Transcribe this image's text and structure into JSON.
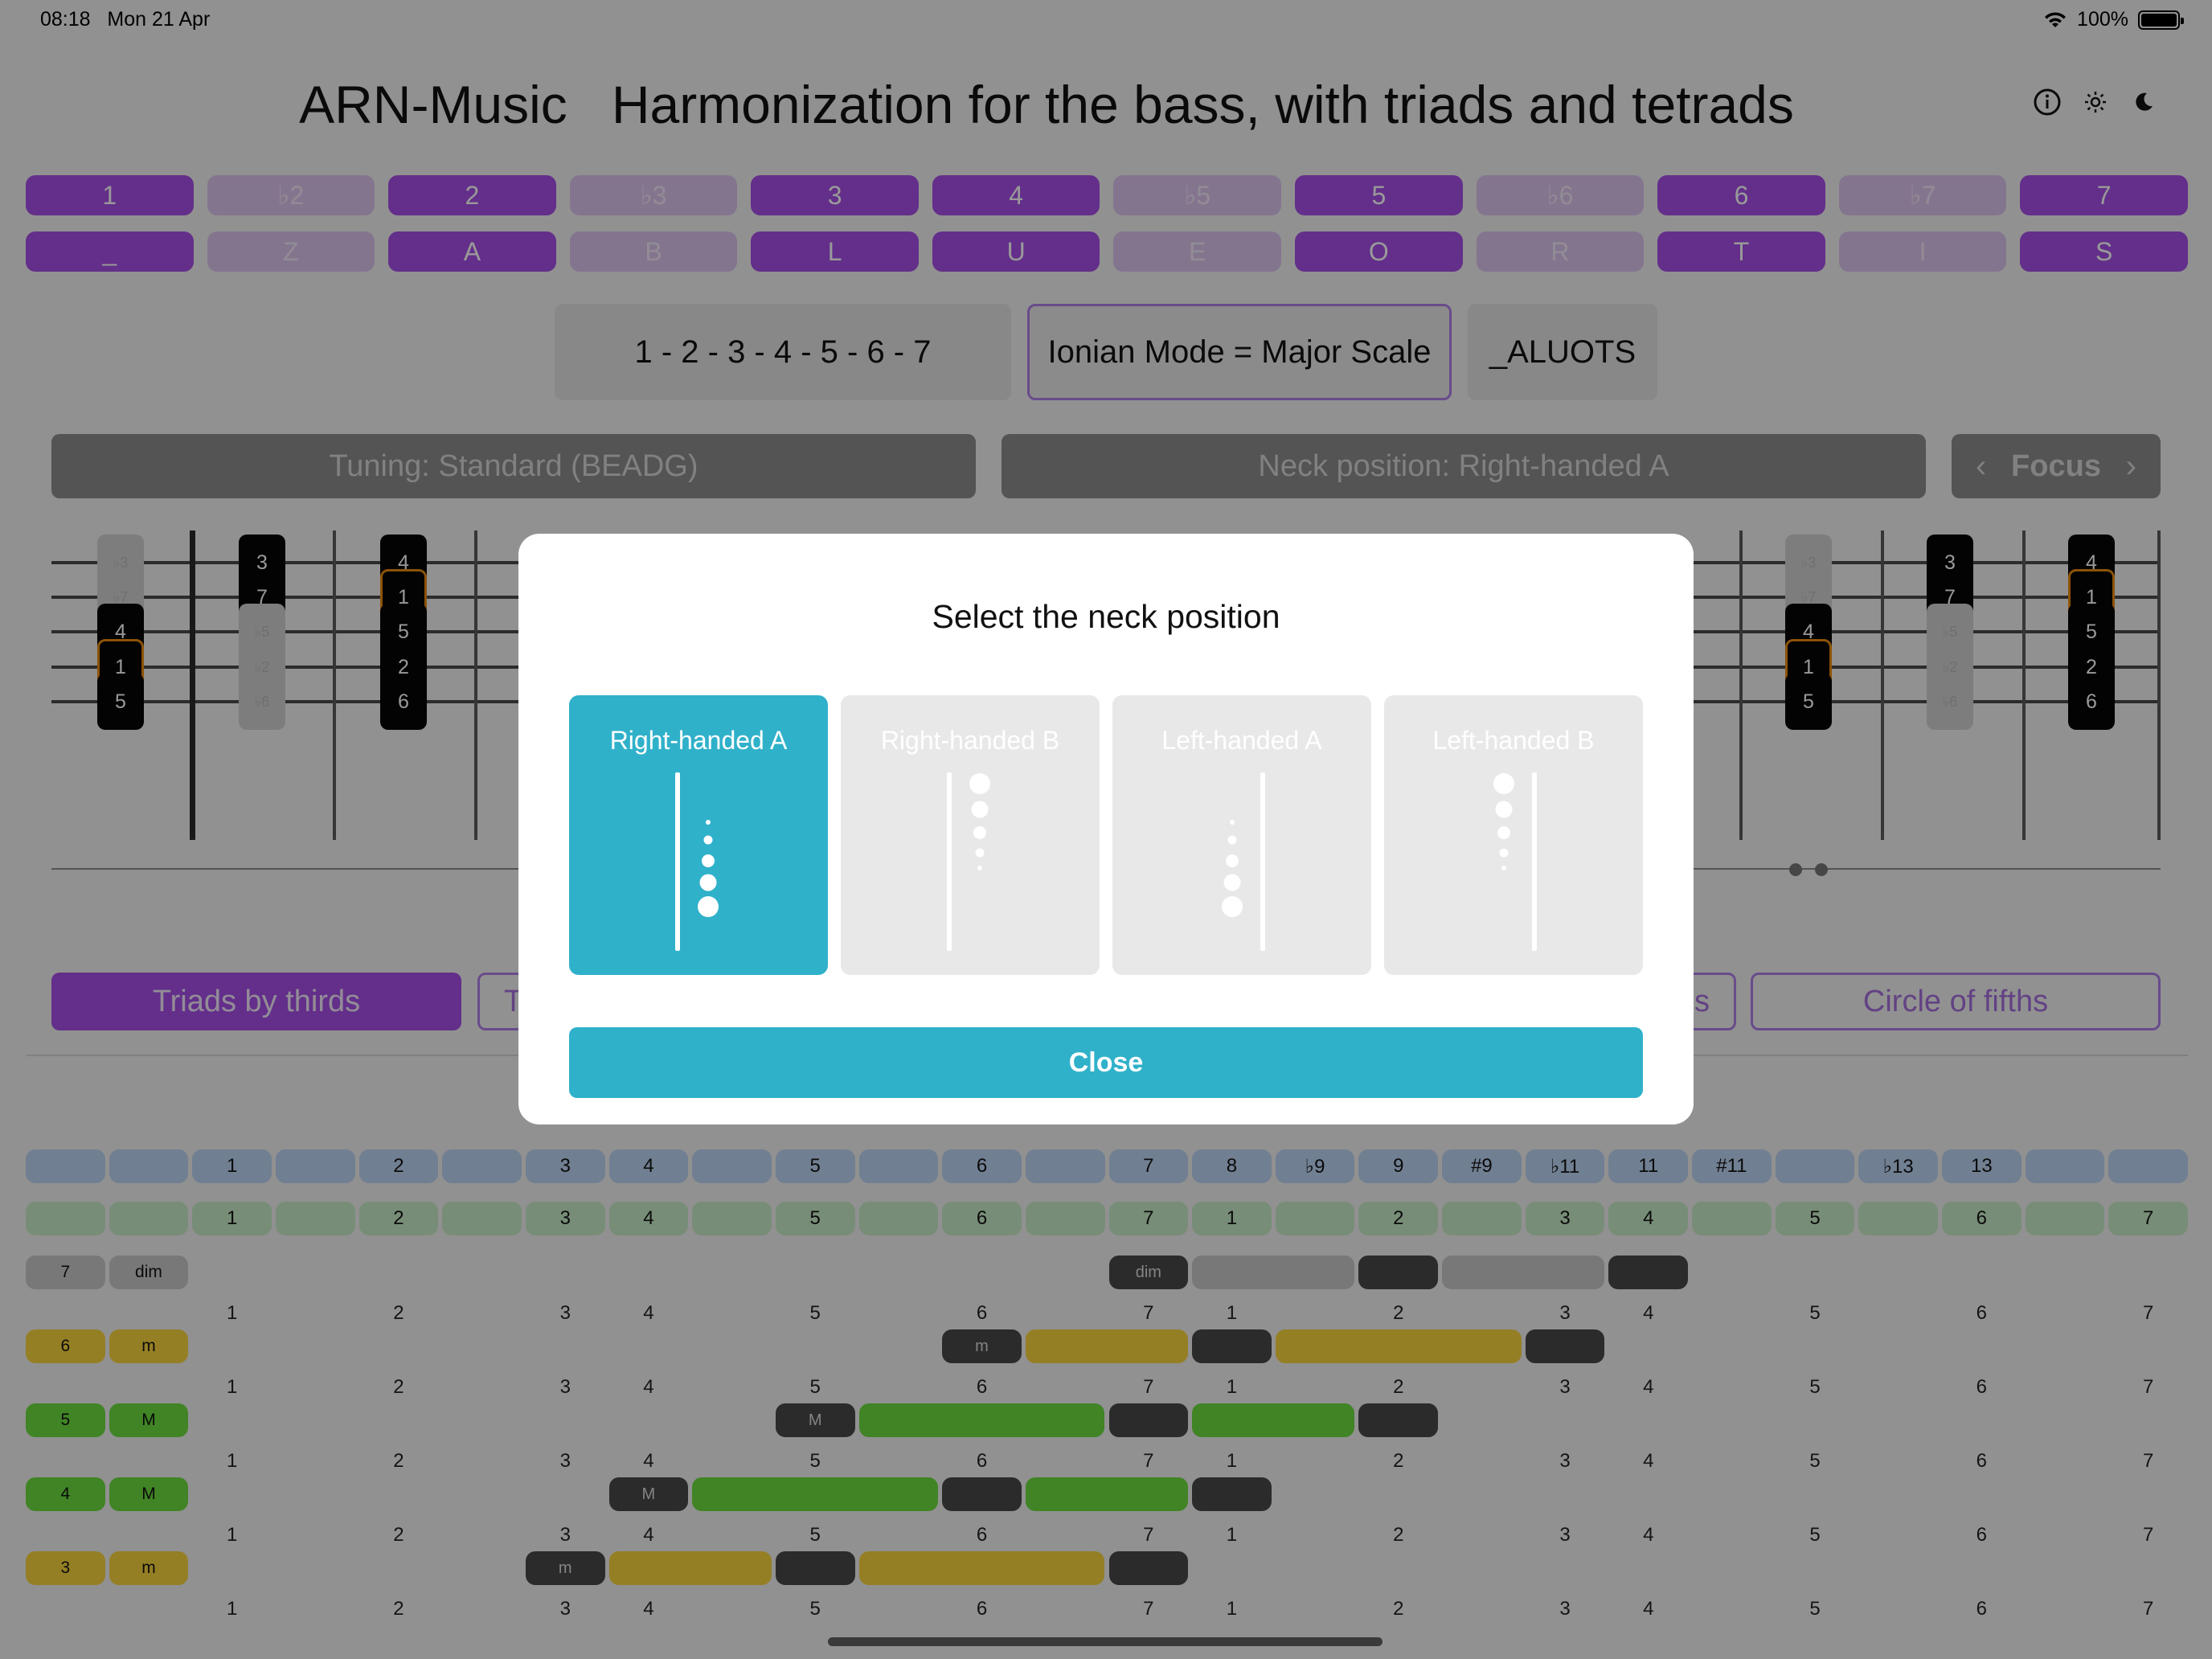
{
  "status": {
    "time": "08:18",
    "date": "Mon 21 Apr",
    "battery": "100%"
  },
  "app": {
    "name": "ARN-Music",
    "subtitle": "Harmonization for the bass, with triads and tetrads"
  },
  "degrees": [
    {
      "label": "1",
      "on": true
    },
    {
      "label": "♭2",
      "on": false
    },
    {
      "label": "2",
      "on": true
    },
    {
      "label": "♭3",
      "on": false
    },
    {
      "label": "3",
      "on": true
    },
    {
      "label": "4",
      "on": true
    },
    {
      "label": "♭5",
      "on": false
    },
    {
      "label": "5",
      "on": true
    },
    {
      "label": "♭6",
      "on": false
    },
    {
      "label": "6",
      "on": true
    },
    {
      "label": "♭7",
      "on": false
    },
    {
      "label": "7",
      "on": true
    }
  ],
  "letters": [
    {
      "label": "_",
      "on": true
    },
    {
      "label": "Z",
      "on": false
    },
    {
      "label": "A",
      "on": true
    },
    {
      "label": "B",
      "on": false
    },
    {
      "label": "L",
      "on": true
    },
    {
      "label": "U",
      "on": true
    },
    {
      "label": "E",
      "on": false
    },
    {
      "label": "O",
      "on": true
    },
    {
      "label": "R",
      "on": false
    },
    {
      "label": "T",
      "on": true
    },
    {
      "label": "I",
      "on": false
    },
    {
      "label": "S",
      "on": true
    }
  ],
  "scale": {
    "formula": "1 - 2 - 3 - 4 - 5 - 6 - 7",
    "mode": "Ionian Mode = Major Scale",
    "code": "_ALUOTS"
  },
  "controls": {
    "tuning": "Tuning: Standard (BEADG)",
    "neck": "Neck position: Right-handed A",
    "focus": "Focus"
  },
  "fretboard": {
    "left_notes": [
      {
        "s": 0,
        "f": 0,
        "t": "♭3",
        "g": true
      },
      {
        "s": 0,
        "f": 1,
        "t": "3"
      },
      {
        "s": 0,
        "f": 2,
        "t": "4"
      },
      {
        "s": 1,
        "f": 0,
        "t": "♭7",
        "g": true
      },
      {
        "s": 1,
        "f": 1,
        "t": "7"
      },
      {
        "s": 1,
        "f": 2,
        "t": "1",
        "r": true
      },
      {
        "s": 2,
        "f": 0,
        "t": "4"
      },
      {
        "s": 2,
        "f": 1,
        "t": "♭5",
        "g": true
      },
      {
        "s": 2,
        "f": 2,
        "t": "5"
      },
      {
        "s": 3,
        "f": 0,
        "t": "1",
        "r": true
      },
      {
        "s": 3,
        "f": 1,
        "t": "♭2",
        "g": true
      },
      {
        "s": 3,
        "f": 2,
        "t": "2"
      },
      {
        "s": 4,
        "f": 0,
        "t": "5"
      },
      {
        "s": 4,
        "f": 1,
        "t": "♭6",
        "g": true
      },
      {
        "s": 4,
        "f": 2,
        "t": "6"
      }
    ],
    "right_notes": [
      {
        "s": 0,
        "f": 0,
        "t": "♭3",
        "g": true
      },
      {
        "s": 0,
        "f": 1,
        "t": "3"
      },
      {
        "s": 0,
        "f": 2,
        "t": "4"
      },
      {
        "s": 1,
        "f": 0,
        "t": "♭7",
        "g": true
      },
      {
        "s": 1,
        "f": 1,
        "t": "7"
      },
      {
        "s": 1,
        "f": 2,
        "t": "1",
        "r": true
      },
      {
        "s": 2,
        "f": 0,
        "t": "4"
      },
      {
        "s": 2,
        "f": 1,
        "t": "♭5",
        "g": true
      },
      {
        "s": 2,
        "f": 2,
        "t": "5"
      },
      {
        "s": 3,
        "f": 0,
        "t": "1",
        "r": true
      },
      {
        "s": 3,
        "f": 1,
        "t": "♭2",
        "g": true
      },
      {
        "s": 3,
        "f": 2,
        "t": "2"
      },
      {
        "s": 4,
        "f": 0,
        "t": "5"
      },
      {
        "s": 4,
        "f": 1,
        "t": "♭6",
        "g": true
      },
      {
        "s": 4,
        "f": 2,
        "t": "6"
      }
    ]
  },
  "tabs": {
    "triads": "Triads by thirds",
    "t2_partial": "T",
    "t3_partial": "s",
    "circle": "Circle of fifths"
  },
  "harmonization": {
    "header_top": [
      "",
      "",
      "1",
      "",
      "2",
      "",
      "3",
      "4",
      "",
      "5",
      "",
      "6",
      "",
      "7",
      "8",
      "♭9",
      "9",
      "#9",
      "♭11",
      "11",
      "#11",
      "",
      "♭13",
      "13",
      "",
      ""
    ],
    "header_bottom": [
      "",
      "",
      "1",
      "",
      "2",
      "",
      "3",
      "4",
      "",
      "5",
      "",
      "6",
      "",
      "7",
      "1",
      "",
      "2",
      "",
      "3",
      "4",
      "",
      "5",
      "",
      "6",
      "",
      "7"
    ],
    "number_row": [
      "",
      "",
      "1",
      "",
      "2",
      "",
      "3",
      "4",
      "",
      "5",
      "",
      "6",
      "",
      "7",
      "1",
      "",
      "2",
      "",
      "3",
      "4",
      "",
      "5",
      "",
      "6",
      "",
      "7"
    ],
    "rows": [
      {
        "degree": "7",
        "quality": "dim",
        "color": "#c8c8c8",
        "start": 13,
        "segments": [
          [
            "dark",
            13,
            1
          ],
          [
            "grey",
            14,
            2
          ],
          [
            "dark",
            16,
            1
          ],
          [
            "grey",
            17,
            2
          ],
          [
            "dark",
            19,
            1
          ]
        ]
      },
      {
        "degree": "6",
        "quality": "m",
        "color": "#f8d43e",
        "start": 11,
        "segments": [
          [
            "dark",
            11,
            1
          ],
          [
            "gold",
            12,
            2
          ],
          [
            "dark",
            14,
            1
          ],
          [
            "gold",
            15,
            3
          ],
          [
            "dark",
            18,
            1
          ]
        ]
      },
      {
        "degree": "5",
        "quality": "M",
        "color": "#6bdc3e",
        "start": 9,
        "segments": [
          [
            "dark",
            9,
            1
          ],
          [
            "green",
            10,
            3
          ],
          [
            "dark",
            13,
            1
          ],
          [
            "green",
            14,
            2
          ],
          [
            "dark",
            16,
            1
          ]
        ]
      },
      {
        "degree": "4",
        "quality": "M",
        "color": "#6bdc3e",
        "start": 7,
        "segments": [
          [
            "dark",
            7,
            1
          ],
          [
            "green",
            8,
            3
          ],
          [
            "dark",
            11,
            1
          ],
          [
            "green",
            12,
            2
          ],
          [
            "dark",
            14,
            1
          ]
        ]
      },
      {
        "degree": "3",
        "quality": "m",
        "color": "#f8d43e",
        "start": 6,
        "segments": [
          [
            "dark",
            6,
            1
          ],
          [
            "gold",
            7,
            2
          ],
          [
            "dark",
            9,
            1
          ],
          [
            "gold",
            10,
            3
          ],
          [
            "dark",
            13,
            1
          ]
        ]
      }
    ]
  },
  "modal": {
    "title": "Select the neck position",
    "options": [
      {
        "label": "Right-handed A",
        "selected": true
      },
      {
        "label": "Right-handed B",
        "selected": false
      },
      {
        "label": "Left-handed A",
        "selected": false
      },
      {
        "label": "Left-handed B",
        "selected": false
      }
    ],
    "close": "Close"
  },
  "colors": {
    "purple": "#a64fe6",
    "teal": "#30b1ca",
    "gold": "#f8d43e",
    "green": "#6bdc3e"
  }
}
